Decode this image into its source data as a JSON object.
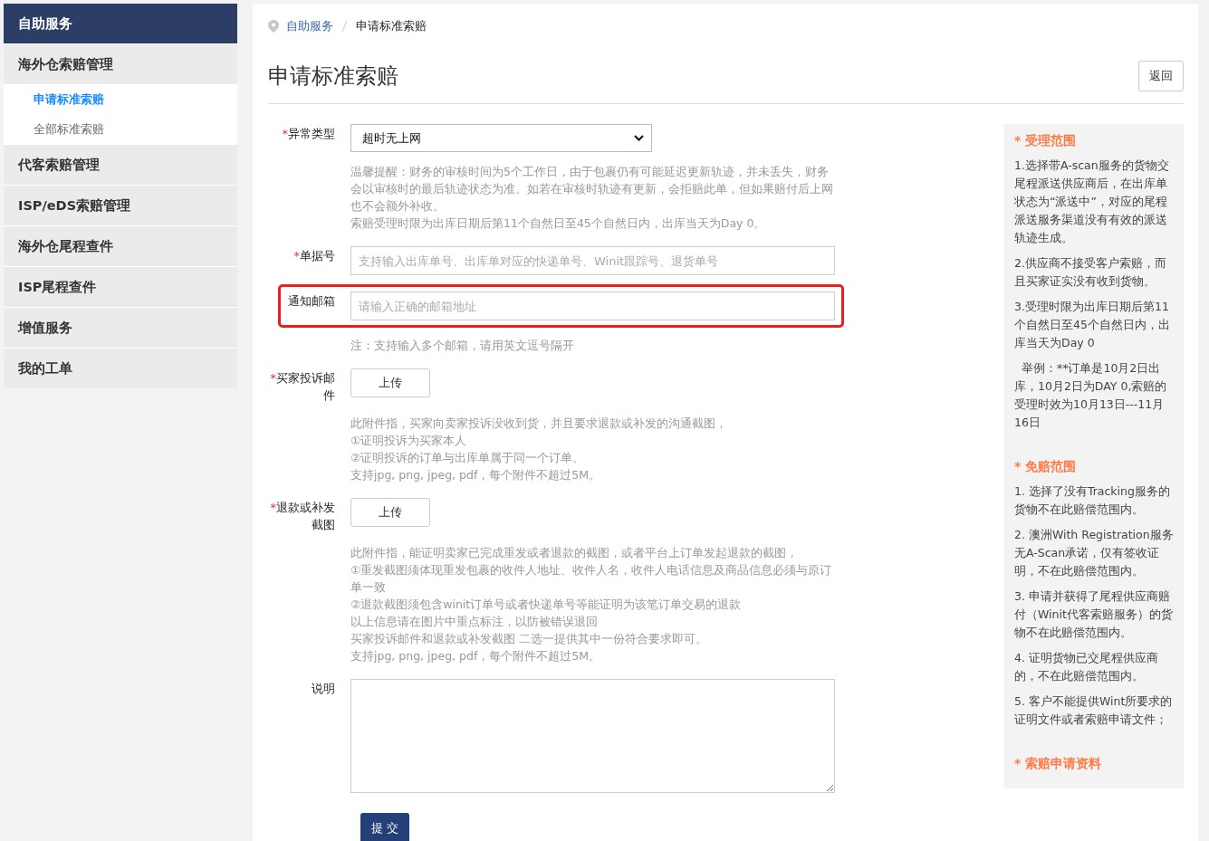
{
  "sidebar": {
    "title": "自助服务",
    "groups": [
      {
        "label": "海外仓索赔管理",
        "children": [
          {
            "label": "申请标准索赔",
            "selected": true
          },
          {
            "label": "全部标准索赔",
            "selected": false
          }
        ]
      },
      {
        "label": "代客索赔管理"
      },
      {
        "label": "ISP/eDS索赔管理"
      },
      {
        "label": "海外仓尾程查件"
      },
      {
        "label": "ISP尾程查件"
      },
      {
        "label": "增值服务"
      },
      {
        "label": "我的工单"
      }
    ]
  },
  "breadcrumb": [
    {
      "label": "自助服务",
      "kind": "link"
    },
    {
      "label": "申请标准索赔",
      "kind": "current"
    }
  ],
  "page_title": "申请标准索赔",
  "back_button": "返回",
  "form": {
    "fields": [
      {
        "kind": "select",
        "label": "异常类型",
        "required_mark": "*",
        "highlighted": false,
        "value": "超时无上网",
        "notes": [
          "温馨提醒：财务的审核时间为5个工作日，由于包裹仍有可能延迟更新轨迹，并未丢失，财务会以审核时的最后轨迹状态为准。如若在审核时轨迹有更新，会拒赔此单，但如果赔付后上网也不会额外补收。",
          "索赔受理时限为出库日期后第11个自然日至45个自然日内，出库当天为Day 0。"
        ]
      },
      {
        "kind": "input",
        "label": "单据号",
        "required_mark": "*",
        "highlighted": false,
        "placeholder": "支持输入出库单号、出库单对应的快递单号、Winit跟踪号、退货单号"
      },
      {
        "kind": "input",
        "label": "通知邮箱",
        "highlighted": true,
        "placeholder": "请输入正确的邮箱地址",
        "notes": [
          "注：支持输入多个邮箱，请用英文逗号隔开"
        ]
      },
      {
        "kind": "upload",
        "label": "买家投诉邮件",
        "required_mark": "*",
        "highlighted": false,
        "button": "上传",
        "notes": [
          "此附件指，买家向卖家投诉没收到货，并且要求退款或补发的沟通截图，",
          "①证明投诉为买家本人",
          "②证明投诉的订单与出库单属于同一个订单。",
          "支持jpg, png, jpeg, pdf，每个附件不超过5M。"
        ]
      },
      {
        "kind": "upload",
        "label": "退款或补发截图",
        "required_mark": "*",
        "highlighted": false,
        "button": "上传",
        "notes": [
          "此附件指，能证明卖家已完成重发或者退款的截图，或者平台上订单发起退款的截图，",
          "①重发截图须体现重发包裹的收件人地址、收件人名，收件人电话信息及商品信息必须与原订单一致",
          "②退款截图须包含winit订单号或者快递单号等能证明为该笔订单交易的退款",
          "以上信息请在图片中重点标注，以防被错误退回",
          "买家投诉邮件和退款或补发截图 二选一提供其中一份符合要求即可。",
          "支持jpg, png, jpeg, pdf，每个附件不超过5M。"
        ]
      },
      {
        "kind": "textarea",
        "label": "说明",
        "highlighted": false
      }
    ],
    "submit_button": "提 交"
  },
  "info_panel": [
    {
      "title": "* 受理范围",
      "paragraphs": [
        "1.选择带A-scan服务的货物交尾程派送供应商后，在出库单状态为“派送中”，对应的尾程派送服务渠道没有有效的派送轨迹生成。",
        "2.供应商不接受客户索赔，而且买家证实没有收到货物。",
        "3.受理时限为出库日期后第11个自然日至45个自然日内，出库当天为Day 0",
        "  举例：**订单是10月2日出库，10月2日为DAY 0,索赔的受理时效为10月13日---11月16日"
      ]
    },
    {
      "title": "* 免赔范围",
      "paragraphs": [
        "1. 选择了没有Tracking服务的货物不在此赔偿范围内。",
        "2. 澳洲With Registration服务无A-Scan承诺，仅有签收证明，不在此赔偿范围内。",
        "3. 申请并获得了尾程供应商赔付（Winit代客索赔服务）的货物不在此赔偿范围内。",
        "4. 证明货物已交尾程供应商的，不在此赔偿范围内。",
        "5. 客户不能提供Wint所要求的证明文件或者索赔申请文件；"
      ]
    },
    {
      "title": "* 索赔申请资料"
    }
  ]
}
